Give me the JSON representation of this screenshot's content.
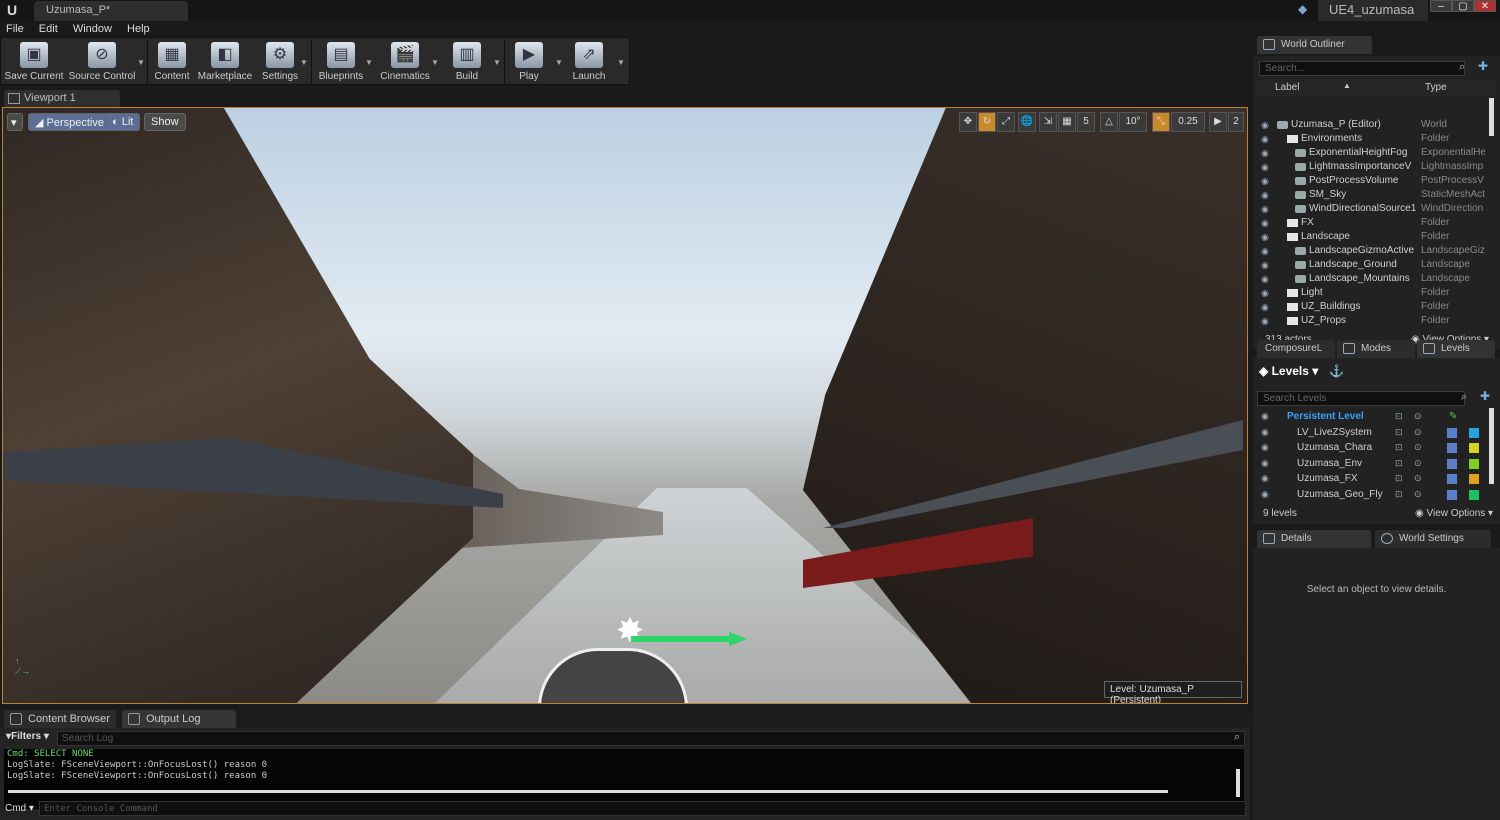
{
  "window": {
    "doc_tab": "Uzumasa_P*",
    "project_name": "UE4_uzumasa",
    "logo": "U",
    "minimize": "–",
    "maximize": "▢",
    "close": "✕"
  },
  "menu": [
    "File",
    "Edit",
    "Window",
    "Help"
  ],
  "toolbar": {
    "buttons": [
      {
        "label": "Save Current",
        "icon": "save-icon"
      },
      {
        "label": "Source Control",
        "icon": "source-control-icon"
      },
      {
        "label": "Content",
        "icon": "content-icon"
      },
      {
        "label": "Marketplace",
        "icon": "marketplace-icon"
      },
      {
        "label": "Settings",
        "icon": "settings-icon"
      },
      {
        "label": "Blueprints",
        "icon": "blueprints-icon"
      },
      {
        "label": "Cinematics",
        "icon": "cinematics-icon"
      },
      {
        "label": "Build",
        "icon": "build-icon"
      },
      {
        "label": "Play",
        "icon": "play-icon"
      },
      {
        "label": "Launch",
        "icon": "launch-icon"
      }
    ]
  },
  "viewport": {
    "tab_label": "Viewport 1",
    "perspective": "Perspective",
    "lit": "Lit",
    "show": "Show",
    "grid_snap": "5",
    "rotation_snap": "10°",
    "scale_snap": "0.25",
    "camera_speed": "2",
    "level_label": "Level:",
    "level_name": "Uzumasa_P (Persistent)"
  },
  "bottom": {
    "tabs": [
      "Content Browser",
      "Output Log"
    ],
    "filters": "Filters",
    "search_placeholder": "Search Log",
    "log_lines": [
      "Cmd: SELECT NONE",
      "LogSlate: FSceneViewport::OnFocusLost() reason 0",
      "LogSlate: FSceneViewport::OnFocusLost() reason 0"
    ],
    "cmd_label": "Cmd",
    "cmd_placeholder": "Enter Console Command"
  },
  "outliner": {
    "tab": "World Outliner",
    "search_placeholder": "Search...",
    "col_label": "Label",
    "col_type": "Type",
    "rows": [
      {
        "label": "Uzumasa_P (Editor)",
        "type": "World"
      },
      {
        "label": "Environments",
        "type": "Folder"
      },
      {
        "label": "ExponentialHeightFog",
        "type": "ExponentialHe"
      },
      {
        "label": "LightmassImportanceV",
        "type": "LightmassImp"
      },
      {
        "label": "PostProcessVolume",
        "type": "PostProcessV"
      },
      {
        "label": "SM_Sky",
        "type": "StaticMeshAct"
      },
      {
        "label": "WindDirectionalSource1",
        "type": "WindDirection"
      },
      {
        "label": "FX",
        "type": "Folder"
      },
      {
        "label": "Landscape",
        "type": "Folder"
      },
      {
        "label": "LandscapeGizmoActive",
        "type": "LandscapeGiz"
      },
      {
        "label": "Landscape_Ground",
        "type": "Landscape"
      },
      {
        "label": "Landscape_Mountains",
        "type": "Landscape"
      },
      {
        "label": "Light",
        "type": "Folder"
      },
      {
        "label": "UZ_Buildings",
        "type": "Folder"
      },
      {
        "label": "UZ_Props",
        "type": "Folder"
      }
    ],
    "actor_count": "313 actors",
    "view_options": "View Options"
  },
  "levels": {
    "tabs": [
      "ComposureL",
      "Modes",
      "Levels"
    ],
    "title": "Levels",
    "search_placeholder": "Search Levels",
    "rows": [
      {
        "name": "Persistent Level",
        "color": ""
      },
      {
        "name": "LV_LiveZSystem",
        "color": "#29a3e0"
      },
      {
        "name": "Uzumasa_Chara",
        "color": "#d8d020"
      },
      {
        "name": "Uzumasa_Env",
        "color": "#80d020"
      },
      {
        "name": "Uzumasa_FX",
        "color": "#e0a020"
      },
      {
        "name": "Uzumasa_Geo_Fly",
        "color": "#20c060"
      }
    ],
    "count": "9 levels",
    "view_options": "View Options"
  },
  "details": {
    "tabs": [
      "Details",
      "World Settings"
    ],
    "message": "Select an object to view details."
  },
  "colors": {
    "accent_selected": "#3aa0ff",
    "viewport_border": "#c08030"
  }
}
